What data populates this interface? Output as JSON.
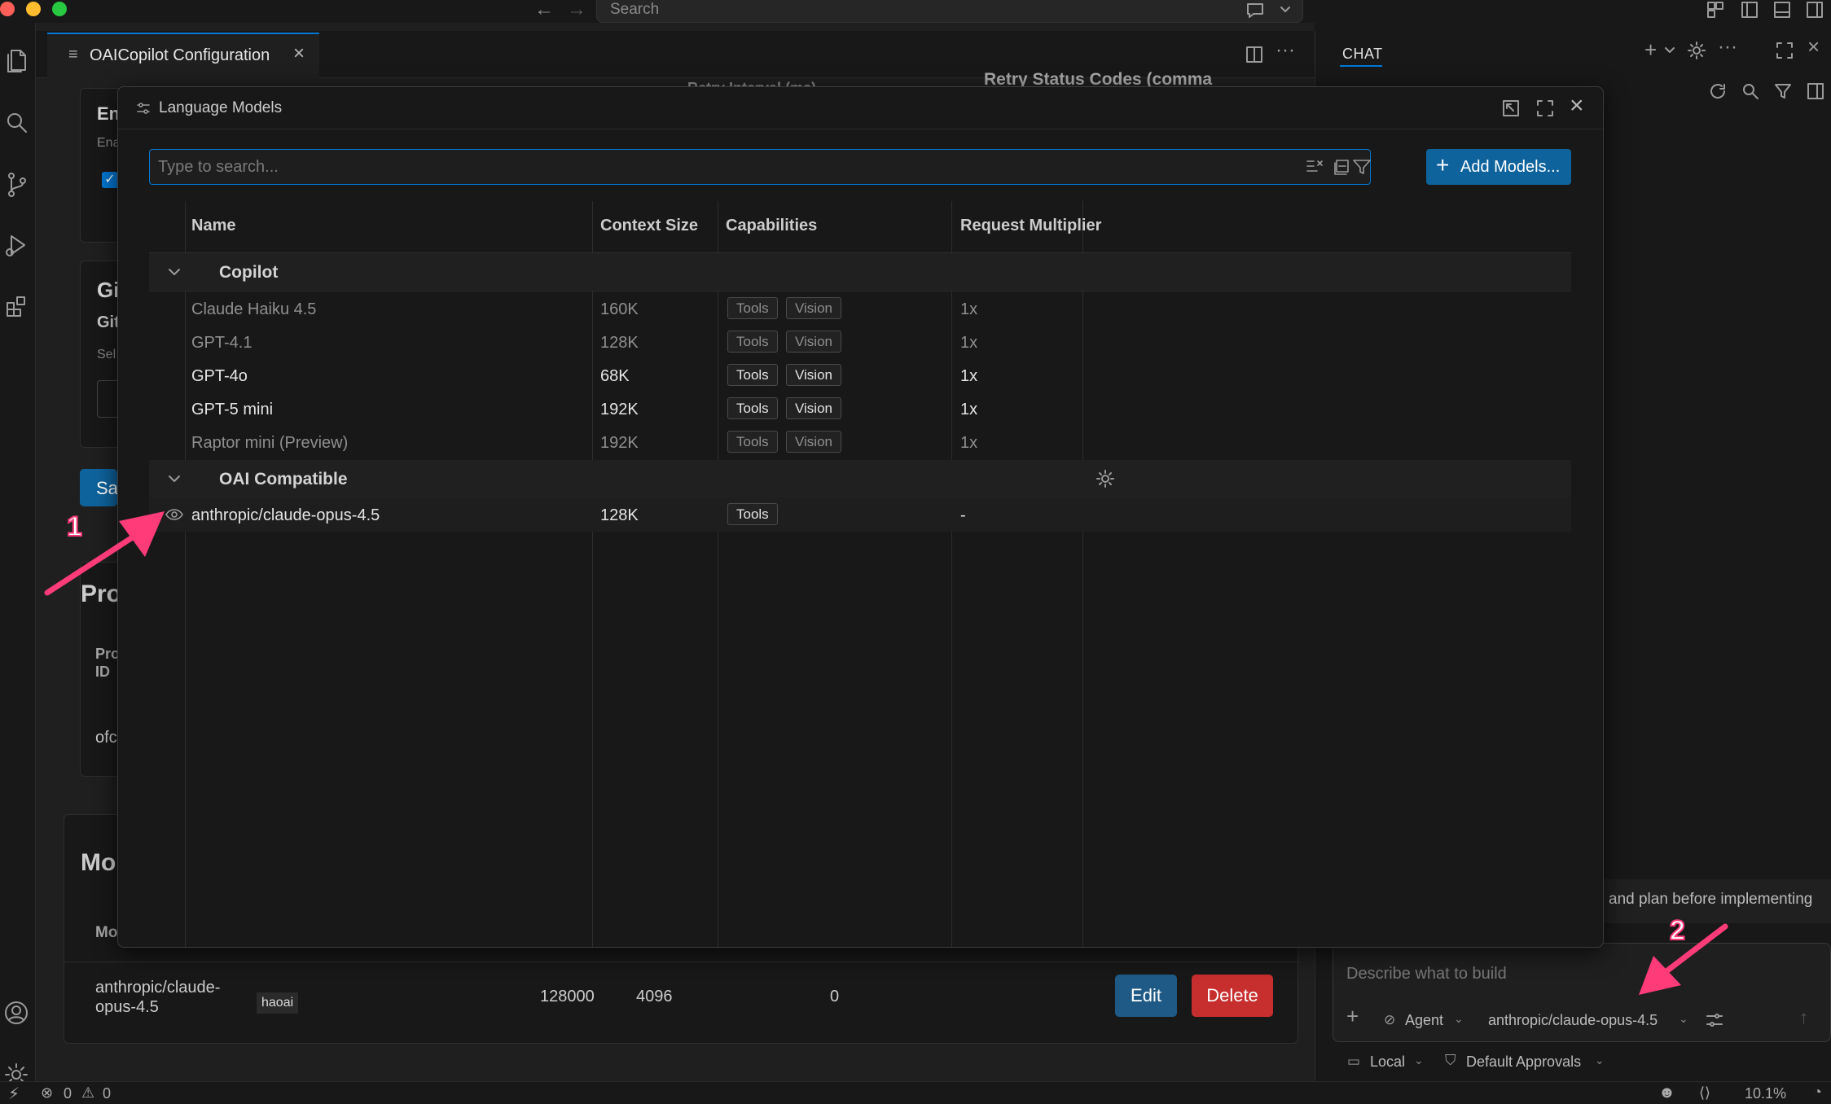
{
  "titlebar": {
    "search_placeholder": "Search"
  },
  "editor": {
    "tab_label": "OAICopilot Configuration",
    "peek_headers": [
      "Retry Status Codes (comma",
      "Retry Interval (ms)"
    ],
    "left_clips": [
      "En",
      "Ena",
      "Gi",
      "Git",
      "Sel",
      "Sa",
      "Pro",
      "Pro",
      "ID",
      "ofc",
      "Mo",
      "Mo"
    ],
    "model_row": {
      "id": "anthropic/claude-opus-4.5",
      "provider": "haoai",
      "context_length": "128000",
      "max_tokens": "4096",
      "value": "0",
      "edit_label": "Edit",
      "delete_label": "Delete"
    }
  },
  "chat": {
    "title": "CHAT",
    "hint": "and plan before implementing",
    "input_placeholder": "Describe what to build",
    "mode": "Agent",
    "model": "anthropic/claude-opus-4.5",
    "location": "Local",
    "approvals": "Default Approvals"
  },
  "dialog": {
    "title": "Language Models",
    "search_placeholder": "Type to search...",
    "add_button": "Add Models...",
    "columns": {
      "name": "Name",
      "context": "Context Size",
      "capabilities": "Capabilities",
      "multiplier": "Request Multiplier"
    },
    "groups": [
      {
        "name": "Copilot",
        "models": [
          {
            "name": "Claude Haiku 4.5",
            "context": "160K",
            "caps": [
              "Tools",
              "Vision"
            ],
            "multiplier": "1x",
            "enabled": false
          },
          {
            "name": "GPT-4.1",
            "context": "128K",
            "caps": [
              "Tools",
              "Vision"
            ],
            "multiplier": "1x",
            "enabled": false
          },
          {
            "name": "GPT-4o",
            "context": "68K",
            "caps": [
              "Tools",
              "Vision"
            ],
            "multiplier": "1x",
            "enabled": true
          },
          {
            "name": "GPT-5 mini",
            "context": "192K",
            "caps": [
              "Tools",
              "Vision"
            ],
            "multiplier": "1x",
            "enabled": true
          },
          {
            "name": "Raptor mini (Preview)",
            "context": "192K",
            "caps": [
              "Tools",
              "Vision"
            ],
            "multiplier": "1x",
            "enabled": false
          }
        ]
      },
      {
        "name": "OAI Compatible",
        "models": [
          {
            "name": "anthropic/claude-opus-4.5",
            "context": "128K",
            "caps": [
              "Tools"
            ],
            "multiplier": "-",
            "enabled": true
          }
        ]
      }
    ]
  },
  "annotations": [
    "1",
    "2"
  ],
  "status": {
    "errors": "0",
    "warnings": "0",
    "zoom": "10.1%"
  },
  "colors": {
    "accent": "#0078d4",
    "primary_button": "#0e639c",
    "danger": "#c72e2e",
    "annotation": "#ff3b7a"
  }
}
